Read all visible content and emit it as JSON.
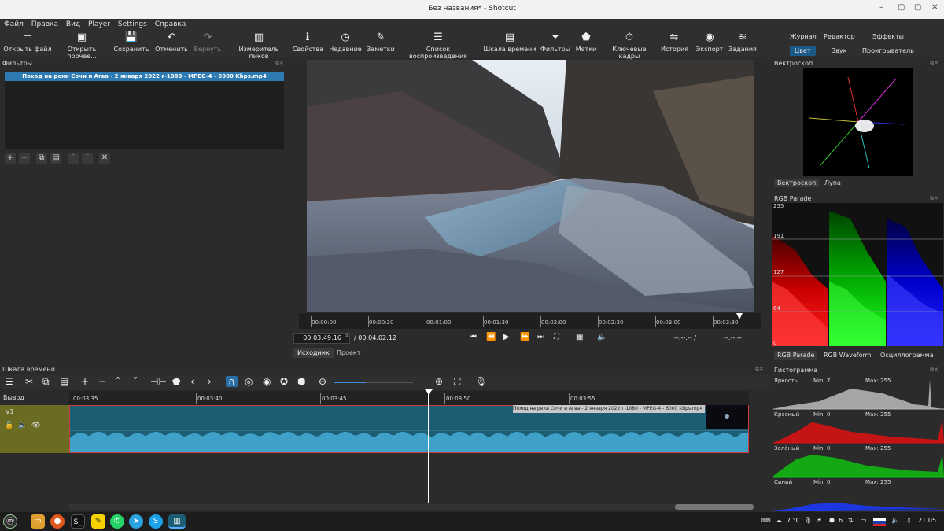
{
  "window": {
    "title": "Без названия* - Shotcut"
  },
  "menu": [
    "Файл",
    "Правка",
    "Вид",
    "Player",
    "Settings",
    "Справка"
  ],
  "toolbar": [
    {
      "label": "Открыть файл",
      "icon": "open-file-icon",
      "glyph": "▭"
    },
    {
      "label": "Открыть прочее...",
      "icon": "open-other-icon",
      "glyph": "▣"
    },
    {
      "label": "Сохранить",
      "icon": "save-icon",
      "glyph": "💾"
    },
    {
      "label": "Отменить",
      "icon": "undo-icon",
      "glyph": "↶"
    },
    {
      "label": "Вернуть",
      "icon": "redo-icon",
      "glyph": "↷"
    },
    {
      "label": "Измеритель пиков",
      "icon": "peak-meter-icon",
      "glyph": "▥"
    },
    {
      "label": "Свойства",
      "icon": "info-icon",
      "glyph": "ℹ"
    },
    {
      "label": "Недавние",
      "icon": "clock-icon",
      "glyph": "◷"
    },
    {
      "label": "Заметки",
      "icon": "notes-icon",
      "glyph": "✎"
    },
    {
      "label": "Список воспроизведения",
      "icon": "playlist-icon",
      "glyph": "☰"
    },
    {
      "label": "Шкала времени",
      "icon": "timeline-icon",
      "glyph": "▤"
    },
    {
      "label": "Фильтры",
      "icon": "filter-icon",
      "glyph": "⏷"
    },
    {
      "label": "Метки",
      "icon": "marker-icon",
      "glyph": "⬟"
    },
    {
      "label": "Ключевые кадры",
      "icon": "keyframes-icon",
      "glyph": "⏱"
    },
    {
      "label": "История",
      "icon": "history-icon",
      "glyph": "⇋"
    },
    {
      "label": "Экспорт",
      "icon": "export-icon",
      "glyph": "◉"
    },
    {
      "label": "Задания",
      "icon": "jobs-icon",
      "glyph": "≋"
    }
  ],
  "layouts": {
    "top": [
      "Журнал",
      "Редактор",
      "Эффекты"
    ],
    "bottom": [
      "Цвет",
      "Звук",
      "Проигрыватель"
    ]
  },
  "filters": {
    "title": "Фильтры",
    "file": "Поход на реки Сочи и Агва - 2 января 2022 г-1080 - MPEG-4 - 6000 Kbps.mp4"
  },
  "player": {
    "ruler": [
      "00:00:00",
      "00:00:30",
      "00:01:00",
      "00:01:30",
      "00:02:00",
      "00:02:30",
      "00:03:00",
      "00:03:30"
    ],
    "position": "00:03:49:16",
    "duration": "/ 00:04:02:12",
    "in": "--:--:-- /",
    "out": "--:--:--",
    "tabs": [
      "Исходник",
      "Проект"
    ]
  },
  "vectorscope": {
    "title": "Вектроскоп",
    "tabs": [
      "Вектроскоп",
      "Лупа"
    ]
  },
  "parade": {
    "title": "RGB Parade",
    "levels": [
      "255",
      "191",
      "127",
      "64",
      "0"
    ],
    "tabs": [
      "RGB Parade",
      "RGB Waveform",
      "Осциллограмма"
    ]
  },
  "histogram": {
    "title": "Гистограмма",
    "rows": [
      {
        "label": "Яркость",
        "min": "Min: 7",
        "max": "Max: 255",
        "color": "#bbbbbb"
      },
      {
        "label": "Красный",
        "min": "Min: 0",
        "max": "Max: 255",
        "color": "#e01010"
      },
      {
        "label": "Зелёный",
        "min": "Min: 0",
        "max": "Max: 255",
        "color": "#10c010"
      },
      {
        "label": "Синий",
        "min": "Min: 0",
        "max": "Max: 255",
        "color": "#1a3aff"
      }
    ]
  },
  "timeline": {
    "title": "Шкала времени",
    "output": "Вывод",
    "track": "V1",
    "ruler": [
      "00:03:35",
      "00:03:40",
      "00:03:45",
      "00:03:50",
      "00:03:55"
    ],
    "clip": "Поход на реки Сочи и Агва - 2 января 2022 г-1080 - MPEG-4 - 6000 Kbps.mp4"
  },
  "taskbar": {
    "weather": "7 °C",
    "count": "6",
    "time": "21:05"
  }
}
